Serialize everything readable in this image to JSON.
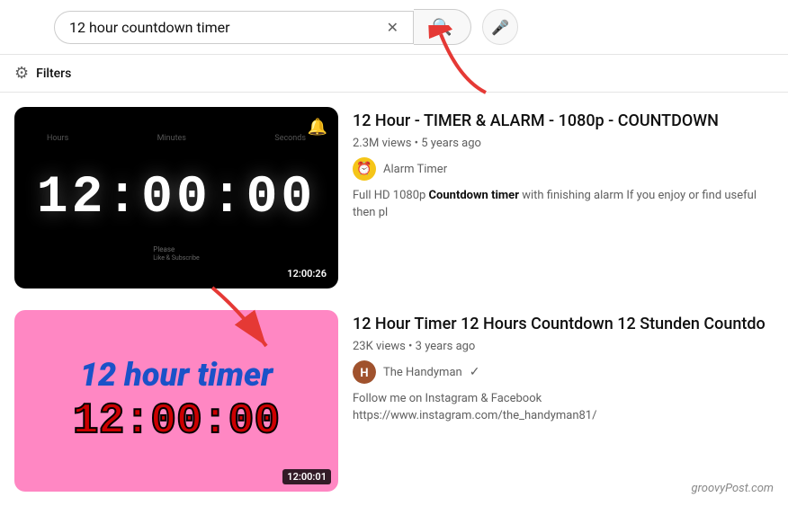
{
  "header": {
    "search_value": "12 hour countdown timer",
    "clear_btn_label": "✕",
    "search_icon": "🔍",
    "mic_icon": "🎤"
  },
  "filters": {
    "label": "Filters",
    "icon": "⚙"
  },
  "results": [
    {
      "id": "result-1",
      "title": "12 Hour - TIMER & ALARM - 1080p - COUNTDOWN",
      "meta": "2.3M views • 5 years ago",
      "channel_name": "Alarm Timer",
      "channel_avatar_type": "alarm",
      "description_parts": [
        {
          "text": "Full HD 1080p ",
          "bold": false
        },
        {
          "text": "Countdown timer",
          "bold": true
        },
        {
          "text": " with finishing alarm If you enjoy or find useful then pl",
          "bold": false
        }
      ],
      "duration": "12:00:26",
      "thumb_type": "dark",
      "timer_display": "12:00:00",
      "timer_labels": [
        "Hours",
        "Minutes",
        "Seconds"
      ],
      "verified": false
    },
    {
      "id": "result-2",
      "title": "12 Hour Timer 12 Hours Countdown 12 Stunden Countdo",
      "meta": "23K views • 3 years ago",
      "channel_name": "The Handyman",
      "channel_avatar_type": "handyman",
      "description": "Follow me on Instagram & Facebook https://www.instagram.com/the_handyman81/",
      "duration": "12:00:01",
      "thumb_type": "pink",
      "pink_title": "12 hour timer",
      "pink_timer": "12:00:00",
      "verified": true
    }
  ],
  "watermark": "groovyPost.com"
}
